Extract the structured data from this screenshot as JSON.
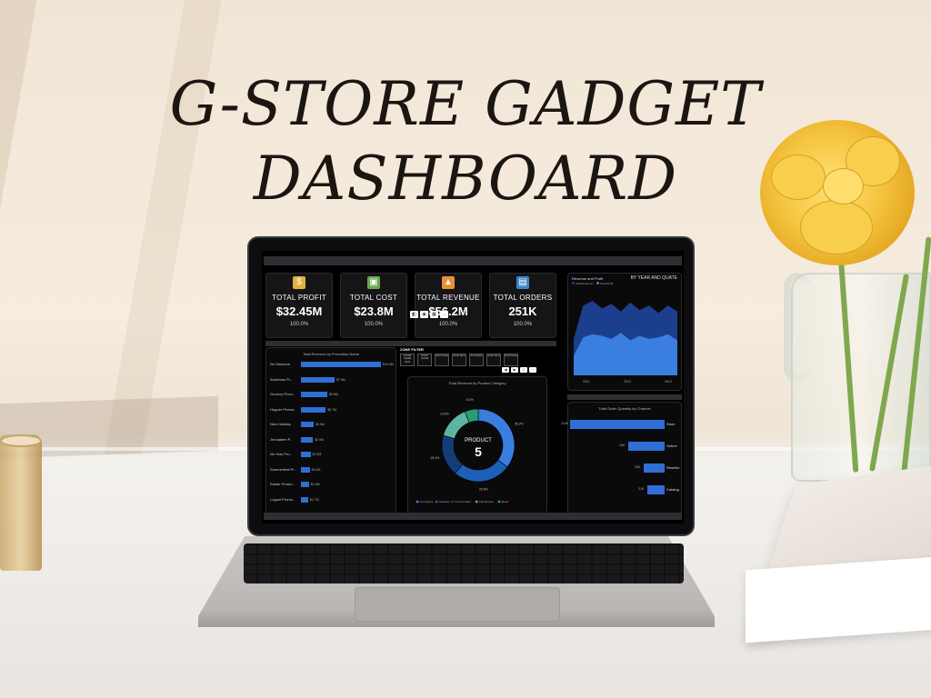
{
  "headline": {
    "line1": "G-STORE GADGET",
    "line2": "DASHBOARD"
  },
  "kpis": [
    {
      "label": "TOTAL PROFIT",
      "value": "$32.45M",
      "pct": "100.0%",
      "icon": "coins-icon",
      "icon_color": "#e0b13c"
    },
    {
      "label": "TOTAL COST",
      "value": "$23.8M",
      "pct": "100.0%",
      "icon": "wallet-icon",
      "icon_color": "#6aa84f"
    },
    {
      "label": "TOTAL REVENUE",
      "value": "$56.2M",
      "pct": "100.0%",
      "icon": "growth-chart-icon",
      "icon_color": "#e69138"
    },
    {
      "label": "TOTAL ORDERS",
      "value": "251K",
      "pct": "100.0%",
      "icon": "box-icon",
      "icon_color": "#3d85c6"
    }
  ],
  "promotion_panel": {
    "title": "Total Revenue by Promotion Name",
    "rows": [
      {
        "label": "No Discount",
        "value": 1.0,
        "text": "$19.3M"
      },
      {
        "label": "American Pr..",
        "value": 0.42,
        "text": "$7.9M"
      },
      {
        "label": "Grocery Prom..",
        "value": 0.33,
        "text": "$5.8M"
      },
      {
        "label": "Hopper Promo..",
        "value": 0.31,
        "text": "$5.7M"
      },
      {
        "label": "New Holiday..",
        "value": 0.16,
        "text": "$3.0M"
      },
      {
        "label": "Jerusalem P..",
        "value": 0.15,
        "text": "$2.9M"
      },
      {
        "label": "No Year Pro..",
        "value": 0.12,
        "text": "$2.3M"
      },
      {
        "label": "Summerfest Pr..",
        "value": 0.11,
        "text": "$2.0M"
      },
      {
        "label": "Easter Promo..",
        "value": 0.1,
        "text": "$1.9M"
      },
      {
        "label": "Lugust Promo..",
        "value": 0.09,
        "text": "$1.7M"
      }
    ]
  },
  "zone_filter": {
    "title": "ZONE FILTER",
    "items": [
      "Central Capital Surfs",
      "Nordic Central",
      "North South",
      "North West",
      "South East",
      "South West",
      "North Texas"
    ],
    "controls": [
      "◀",
      "▶",
      "⇩",
      "⋯"
    ]
  },
  "product_panel": {
    "title": "Total Revenue by Product Category",
    "center_label": "PRODUCT",
    "center_value": "5",
    "slices": [
      {
        "name": "Computers",
        "value": 35.2,
        "color": "#3a7ee0"
      },
      {
        "name": "Cameras",
        "value": 25.8,
        "color": "#1e5fb6"
      },
      {
        "name": "TV and Video",
        "value": 18.4,
        "color": "#163c78"
      },
      {
        "name": "Cell phones",
        "value": 14.6,
        "color": "#5bb5a0"
      },
      {
        "name": "Music",
        "value": 6.0,
        "color": "#2a9d6f"
      }
    ],
    "slice_labels": [
      "35.2%",
      "25.8%",
      "18.4%",
      "14.6%",
      "6.0%"
    ]
  },
  "revenue_profit_panel": {
    "title": "Revenue and Profit",
    "subtitle": "BY YEAR AND QUATE",
    "legend": [
      "Total Revenue",
      "Total Profit"
    ],
    "x_labels": [
      "2011",
      "2012",
      "2013"
    ]
  },
  "channel_panel": {
    "title": "Total Order Quantity by Channel",
    "rows": [
      {
        "label": "Store",
        "value": 1.0,
        "text": "115K"
      },
      {
        "label": "Online",
        "value": 0.38,
        "text": "44K"
      },
      {
        "label": "Reseller",
        "value": 0.22,
        "text": "26K"
      },
      {
        "label": "Catalog",
        "value": 0.18,
        "text": "21K"
      }
    ]
  },
  "chart_data": [
    {
      "type": "bar",
      "title": "Total Revenue by Promotion Name",
      "categories": [
        "No Discount",
        "American Pr..",
        "Grocery Prom..",
        "Hopper Promo..",
        "New Holiday..",
        "Jerusalem P..",
        "No Year Pro..",
        "Summerfest Pr..",
        "Easter Promo..",
        "Lugust Promo.."
      ],
      "values": [
        19.3,
        7.9,
        5.8,
        5.7,
        3.0,
        2.9,
        2.3,
        2.0,
        1.9,
        1.7
      ]
    },
    {
      "type": "pie",
      "title": "Total Revenue by Product Category",
      "categories": [
        "Computers",
        "Cameras",
        "TV and Video",
        "Cell phones",
        "Music"
      ],
      "values": [
        35.2,
        25.8,
        18.4,
        14.6,
        6.0
      ]
    },
    {
      "type": "area",
      "title": "Revenue and Profit",
      "x": [
        "2011",
        "2012",
        "2013"
      ],
      "series": [
        {
          "name": "Total Revenue",
          "values": [
            2.4,
            4.6,
            4.9,
            4.4,
            4.7,
            4.2,
            4.8,
            4.3,
            4.6,
            4.1,
            4.6,
            4.2
          ]
        },
        {
          "name": "Total Profit",
          "values": [
            1.3,
            2.5,
            2.7,
            2.6,
            2.4,
            2.8,
            2.3,
            2.6,
            2.4,
            2.5,
            2.7,
            2.3
          ]
        }
      ]
    },
    {
      "type": "bar",
      "title": "Total Order Quantity by Channel",
      "categories": [
        "Store",
        "Online",
        "Reseller",
        "Catalog"
      ],
      "values": [
        115,
        44,
        26,
        21
      ]
    }
  ]
}
